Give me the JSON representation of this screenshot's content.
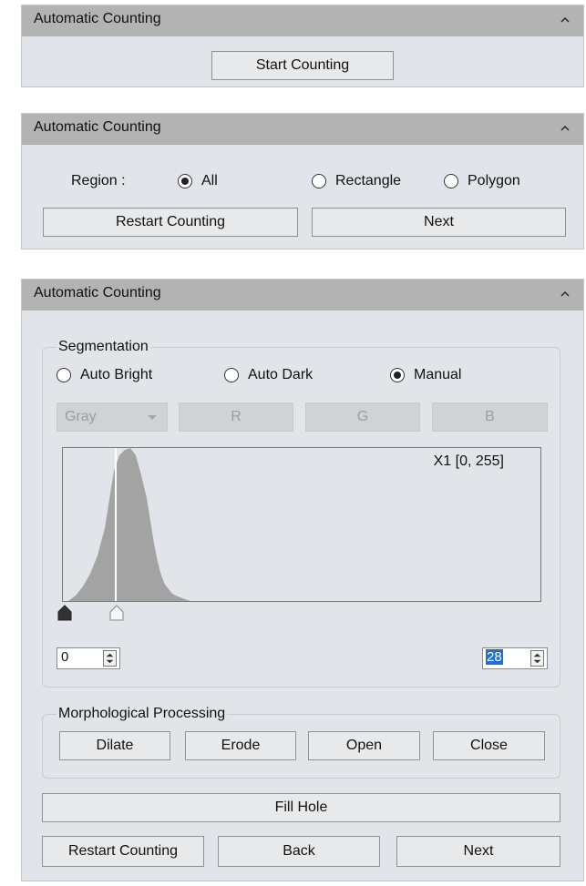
{
  "panel1": {
    "title": "Automatic Counting",
    "start_button": "Start Counting"
  },
  "panel2": {
    "title": "Automatic Counting",
    "region_label": "Region :",
    "region_options": [
      "All",
      "Rectangle",
      "Polygon"
    ],
    "region_selected": "All",
    "restart_button": "Restart Counting",
    "next_button": "Next"
  },
  "panel3": {
    "title": "Automatic Counting",
    "segmentation": {
      "label": "Segmentation",
      "modes": [
        "Auto Bright",
        "Auto Dark",
        "Manual"
      ],
      "selected_mode": "Manual",
      "channel_select": "Gray",
      "channel_buttons": [
        "R",
        "G",
        "B"
      ],
      "histogram_label": "X1 [0, 255]",
      "low_value": "0",
      "high_value": "28"
    },
    "morphology": {
      "label": "Morphological Processing",
      "buttons": [
        "Dilate",
        "Erode",
        "Open",
        "Close"
      ]
    },
    "fill_hole_button": "Fill Hole",
    "restart_button": "Restart Counting",
    "back_button": "Back",
    "next_button": "Next"
  },
  "colors": {
    "panel_bg": "#e1e4e8",
    "header_bg": "#b3b3b3",
    "histogram_fill": "#a3a3a3",
    "selection_highlight": "#1f6fd6"
  }
}
